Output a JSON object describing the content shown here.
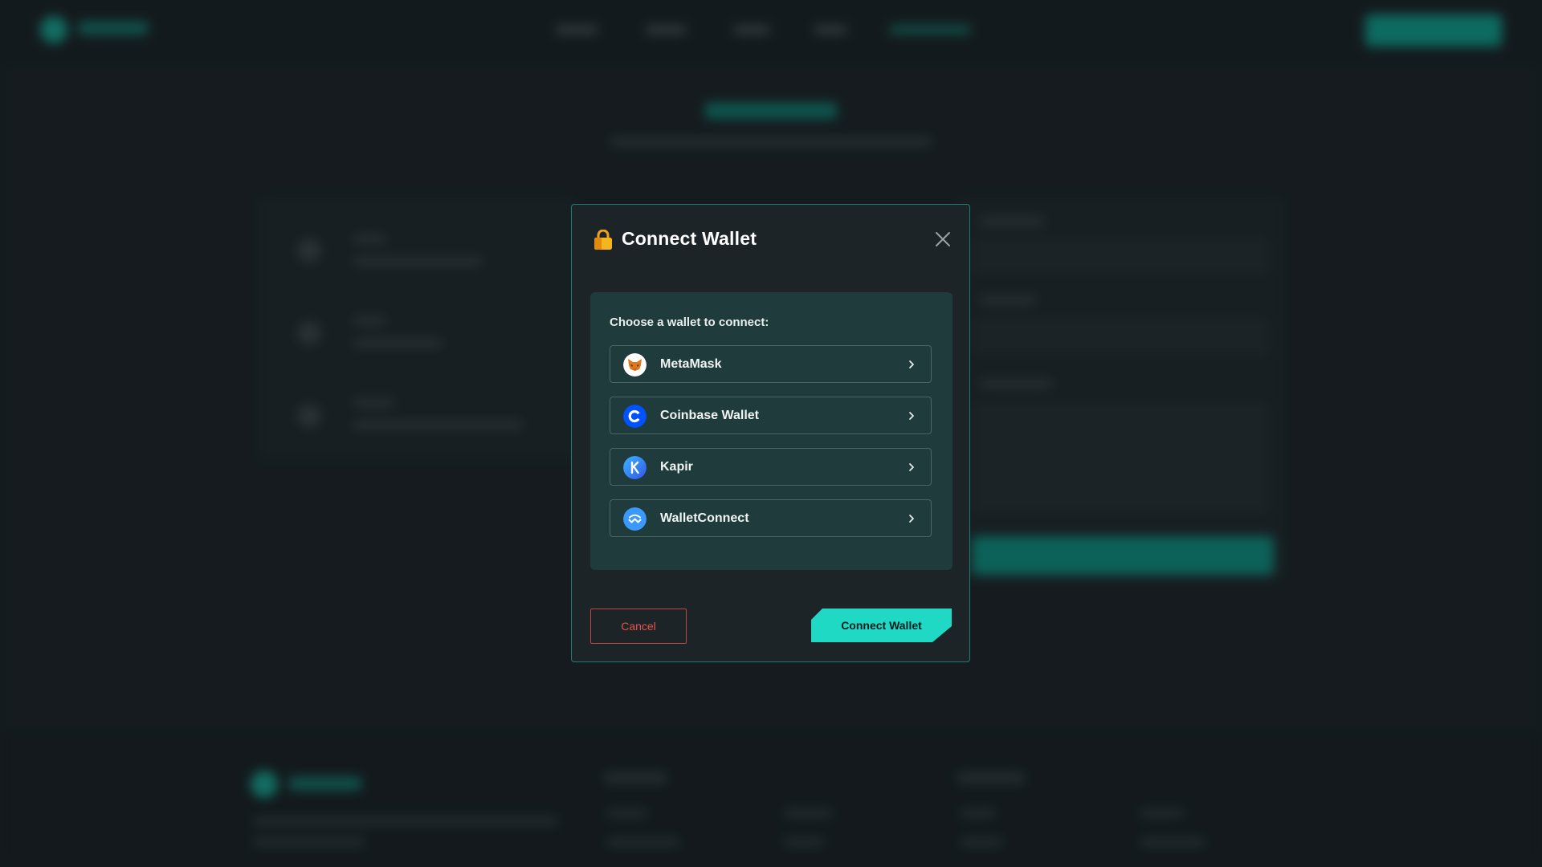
{
  "modal": {
    "title": "Connect Wallet",
    "prompt": "Choose a wallet to connect:",
    "wallets": [
      {
        "label": "MetaMask",
        "icon": "metamask-fox-icon"
      },
      {
        "label": "Coinbase Wallet",
        "icon": "coinbase-icon"
      },
      {
        "label": "Kapir",
        "icon": "kapir-icon"
      },
      {
        "label": "WalletConnect",
        "icon": "walletconnect-icon"
      }
    ],
    "cancel_label": "Cancel",
    "connect_label": "Connect Wallet"
  },
  "colors": {
    "accent": "#1fd9c5",
    "modal_border": "#1f7d73",
    "panel_bg": "#1f3b3c",
    "cancel": "#e5544c",
    "page_bg": "#1b2226"
  }
}
